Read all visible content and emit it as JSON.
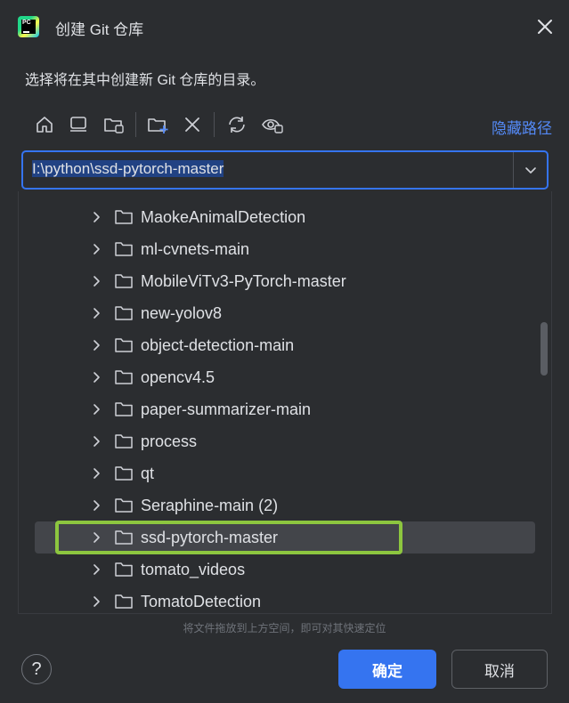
{
  "window": {
    "title": "创建 Git 仓库",
    "app_icon_text": "PC"
  },
  "subtitle": "选择将在其中创建新 Git 仓库的目录。",
  "toolbar": {
    "icons": [
      "home-icon",
      "desktop-icon",
      "project-folder-icon",
      "new-folder-icon",
      "delete-icon",
      "refresh-icon",
      "show-hidden-icon"
    ],
    "hide_path_label": "隐藏路径"
  },
  "path_field": {
    "value": "I:\\python\\ssd-pytorch-master"
  },
  "tree": {
    "items": [
      {
        "label": "MaokeAnimalDetection",
        "selected": false
      },
      {
        "label": "ml-cvnets-main",
        "selected": false
      },
      {
        "label": "MobileViTv3-PyTorch-master",
        "selected": false
      },
      {
        "label": "new-yolov8",
        "selected": false
      },
      {
        "label": "object-detection-main",
        "selected": false
      },
      {
        "label": "opencv4.5",
        "selected": false
      },
      {
        "label": "paper-summarizer-main",
        "selected": false
      },
      {
        "label": "process",
        "selected": false
      },
      {
        "label": "qt",
        "selected": false
      },
      {
        "label": "Seraphine-main (2)",
        "selected": false
      },
      {
        "label": "ssd-pytorch-master",
        "selected": true
      },
      {
        "label": "tomato_videos",
        "selected": false
      },
      {
        "label": "TomatoDetection",
        "selected": false
      }
    ]
  },
  "hint": "将文件拖放到上方空间，即可对其快速定位",
  "buttons": {
    "help": "?",
    "ok": "确定",
    "cancel": "取消"
  },
  "colors": {
    "background": "#2b2d30",
    "accent": "#3574f0",
    "link": "#548af7",
    "selection_row": "#43454a",
    "highlight_box": "#8dc63f"
  }
}
